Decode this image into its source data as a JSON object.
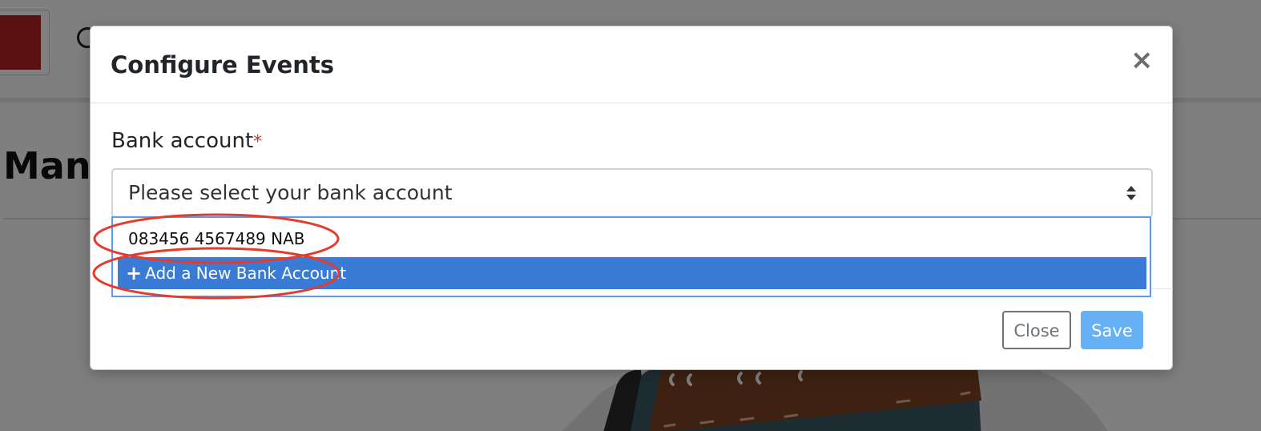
{
  "background": {
    "page_title_fragment": "Mana"
  },
  "modal": {
    "title": "Configure Events",
    "close_icon": "×",
    "field": {
      "label": "Bank account",
      "required_mark": "*",
      "placeholder": "Please select your bank account"
    },
    "options": [
      {
        "label": "083456 4567489 NAB",
        "highlighted": false
      },
      {
        "label": "Add a New Bank Account",
        "icon": "plus-icon",
        "highlighted": true
      }
    ],
    "buttons": {
      "close": "Close",
      "save": "Save"
    }
  },
  "colors": {
    "highlight": "#3a7bd5",
    "save_button": "#66b0f6",
    "annotation": "#e53b2c",
    "required": "#d9342b"
  }
}
